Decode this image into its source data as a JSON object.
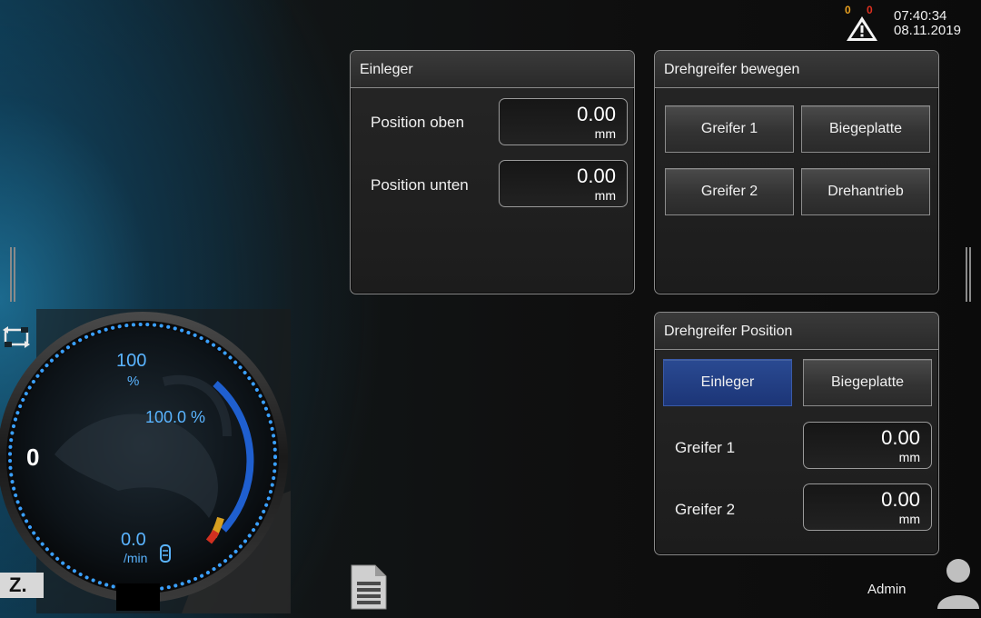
{
  "status": {
    "warnings_count": "0",
    "errors_count": "0",
    "time": "07:40:34",
    "date": "08.11.2019"
  },
  "einleger_panel": {
    "title": "Einleger",
    "rows": [
      {
        "label": "Position oben",
        "value": "0.00",
        "unit": "mm"
      },
      {
        "label": "Position unten",
        "value": "0.00",
        "unit": "mm"
      }
    ]
  },
  "drehgreifer_bewegen_panel": {
    "title": "Drehgreifer bewegen",
    "buttons": [
      "Greifer 1",
      "Biegeplatte",
      "Greifer 2",
      "Drehantrieb"
    ]
  },
  "drehgreifer_position_panel": {
    "title": "Drehgreifer Position",
    "buttons": [
      {
        "label": "Einleger",
        "active": true
      },
      {
        "label": "Biegeplatte",
        "active": false
      }
    ],
    "rows": [
      {
        "label": "Greifer 1",
        "value": "0.00",
        "unit": "mm"
      },
      {
        "label": "Greifer 2",
        "value": "0.00",
        "unit": "mm"
      }
    ]
  },
  "gauge": {
    "override_value": "100",
    "override_unit": "%",
    "load_value": "100.0 %",
    "center_value": "0",
    "speed_value": "0.0",
    "speed_unit": "/min"
  },
  "footer": {
    "user": "Admin",
    "logo": "Z."
  },
  "icons": [
    "warning-triangle-icon",
    "mode-cycle-icon",
    "document-list-icon",
    "user-icon",
    "coolant-icon"
  ],
  "colors": {
    "accent_blue": "#1c3577",
    "gauge_dots": "#3aa0ff",
    "value_text": "#5ab4ff"
  }
}
